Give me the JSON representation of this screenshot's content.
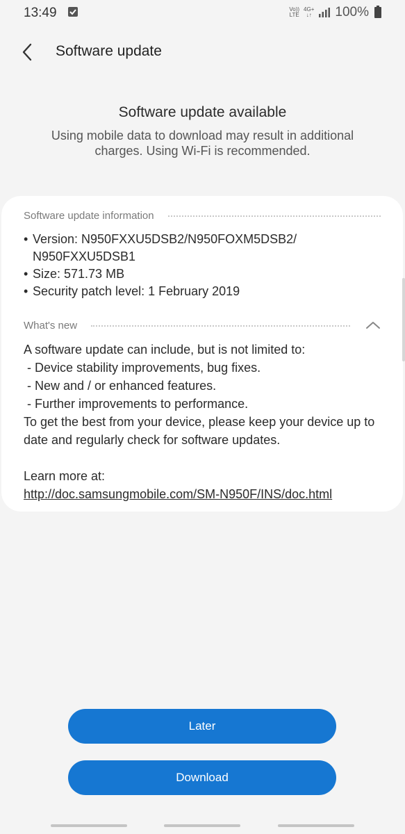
{
  "status_bar": {
    "time": "13:49",
    "volte_top": "Vo))",
    "volte_bottom": "LTE",
    "net_top": "4G+",
    "net_bottom": "↓↑",
    "battery_percent": "100%"
  },
  "header": {
    "title": "Software update"
  },
  "headline": {
    "title": "Software update available",
    "subtitle": "Using mobile data to download may result in additional charges. Using Wi-Fi is recommended."
  },
  "info": {
    "section_title": "Software update information",
    "items": [
      "Version: N950FXXU5DSB2/N950FOXM5DSB2/\nN950FXXU5DSB1",
      "Size: 571.73 MB",
      "Security patch level: 1 February 2019"
    ]
  },
  "whats_new": {
    "section_title": "What's new",
    "lines": [
      "A software update can include, but is not limited to:",
      " - Device stability improvements, bug fixes.",
      " - New and / or enhanced features.",
      " - Further improvements to performance.",
      "To get the best from your device, please keep your device up to date and regularly check for software updates."
    ],
    "learn_more_label": "Learn more at:",
    "link": "http://doc.samsungmobile.com/SM-N950F/INS/doc.html"
  },
  "buttons": {
    "later": "Later",
    "download": "Download"
  },
  "colors": {
    "accent": "#1677d2",
    "background": "#f4f4f4",
    "card": "#ffffff"
  }
}
